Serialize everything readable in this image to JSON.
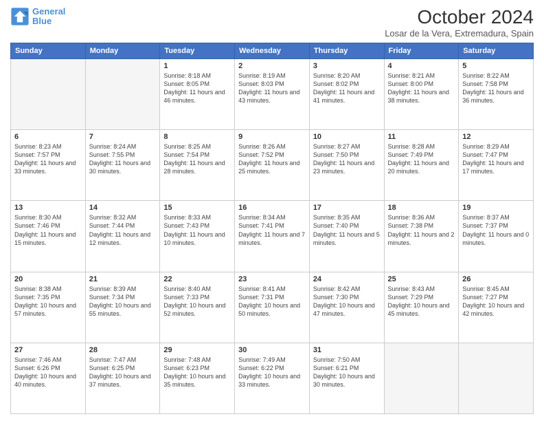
{
  "header": {
    "logo_line1": "General",
    "logo_line2": "Blue",
    "title": "October 2024",
    "subtitle": "Losar de la Vera, Extremadura, Spain"
  },
  "days_of_week": [
    "Sunday",
    "Monday",
    "Tuesday",
    "Wednesday",
    "Thursday",
    "Friday",
    "Saturday"
  ],
  "weeks": [
    [
      {
        "day": "",
        "info": ""
      },
      {
        "day": "",
        "info": ""
      },
      {
        "day": "1",
        "info": "Sunrise: 8:18 AM\nSunset: 8:05 PM\nDaylight: 11 hours and 46 minutes."
      },
      {
        "day": "2",
        "info": "Sunrise: 8:19 AM\nSunset: 8:03 PM\nDaylight: 11 hours and 43 minutes."
      },
      {
        "day": "3",
        "info": "Sunrise: 8:20 AM\nSunset: 8:02 PM\nDaylight: 11 hours and 41 minutes."
      },
      {
        "day": "4",
        "info": "Sunrise: 8:21 AM\nSunset: 8:00 PM\nDaylight: 11 hours and 38 minutes."
      },
      {
        "day": "5",
        "info": "Sunrise: 8:22 AM\nSunset: 7:58 PM\nDaylight: 11 hours and 36 minutes."
      }
    ],
    [
      {
        "day": "6",
        "info": "Sunrise: 8:23 AM\nSunset: 7:57 PM\nDaylight: 11 hours and 33 minutes."
      },
      {
        "day": "7",
        "info": "Sunrise: 8:24 AM\nSunset: 7:55 PM\nDaylight: 11 hours and 30 minutes."
      },
      {
        "day": "8",
        "info": "Sunrise: 8:25 AM\nSunset: 7:54 PM\nDaylight: 11 hours and 28 minutes."
      },
      {
        "day": "9",
        "info": "Sunrise: 8:26 AM\nSunset: 7:52 PM\nDaylight: 11 hours and 25 minutes."
      },
      {
        "day": "10",
        "info": "Sunrise: 8:27 AM\nSunset: 7:50 PM\nDaylight: 11 hours and 23 minutes."
      },
      {
        "day": "11",
        "info": "Sunrise: 8:28 AM\nSunset: 7:49 PM\nDaylight: 11 hours and 20 minutes."
      },
      {
        "day": "12",
        "info": "Sunrise: 8:29 AM\nSunset: 7:47 PM\nDaylight: 11 hours and 17 minutes."
      }
    ],
    [
      {
        "day": "13",
        "info": "Sunrise: 8:30 AM\nSunset: 7:46 PM\nDaylight: 11 hours and 15 minutes."
      },
      {
        "day": "14",
        "info": "Sunrise: 8:32 AM\nSunset: 7:44 PM\nDaylight: 11 hours and 12 minutes."
      },
      {
        "day": "15",
        "info": "Sunrise: 8:33 AM\nSunset: 7:43 PM\nDaylight: 11 hours and 10 minutes."
      },
      {
        "day": "16",
        "info": "Sunrise: 8:34 AM\nSunset: 7:41 PM\nDaylight: 11 hours and 7 minutes."
      },
      {
        "day": "17",
        "info": "Sunrise: 8:35 AM\nSunset: 7:40 PM\nDaylight: 11 hours and 5 minutes."
      },
      {
        "day": "18",
        "info": "Sunrise: 8:36 AM\nSunset: 7:38 PM\nDaylight: 11 hours and 2 minutes."
      },
      {
        "day": "19",
        "info": "Sunrise: 8:37 AM\nSunset: 7:37 PM\nDaylight: 11 hours and 0 minutes."
      }
    ],
    [
      {
        "day": "20",
        "info": "Sunrise: 8:38 AM\nSunset: 7:35 PM\nDaylight: 10 hours and 57 minutes."
      },
      {
        "day": "21",
        "info": "Sunrise: 8:39 AM\nSunset: 7:34 PM\nDaylight: 10 hours and 55 minutes."
      },
      {
        "day": "22",
        "info": "Sunrise: 8:40 AM\nSunset: 7:33 PM\nDaylight: 10 hours and 52 minutes."
      },
      {
        "day": "23",
        "info": "Sunrise: 8:41 AM\nSunset: 7:31 PM\nDaylight: 10 hours and 50 minutes."
      },
      {
        "day": "24",
        "info": "Sunrise: 8:42 AM\nSunset: 7:30 PM\nDaylight: 10 hours and 47 minutes."
      },
      {
        "day": "25",
        "info": "Sunrise: 8:43 AM\nSunset: 7:29 PM\nDaylight: 10 hours and 45 minutes."
      },
      {
        "day": "26",
        "info": "Sunrise: 8:45 AM\nSunset: 7:27 PM\nDaylight: 10 hours and 42 minutes."
      }
    ],
    [
      {
        "day": "27",
        "info": "Sunrise: 7:46 AM\nSunset: 6:26 PM\nDaylight: 10 hours and 40 minutes."
      },
      {
        "day": "28",
        "info": "Sunrise: 7:47 AM\nSunset: 6:25 PM\nDaylight: 10 hours and 37 minutes."
      },
      {
        "day": "29",
        "info": "Sunrise: 7:48 AM\nSunset: 6:23 PM\nDaylight: 10 hours and 35 minutes."
      },
      {
        "day": "30",
        "info": "Sunrise: 7:49 AM\nSunset: 6:22 PM\nDaylight: 10 hours and 33 minutes."
      },
      {
        "day": "31",
        "info": "Sunrise: 7:50 AM\nSunset: 6:21 PM\nDaylight: 10 hours and 30 minutes."
      },
      {
        "day": "",
        "info": ""
      },
      {
        "day": "",
        "info": ""
      }
    ]
  ]
}
